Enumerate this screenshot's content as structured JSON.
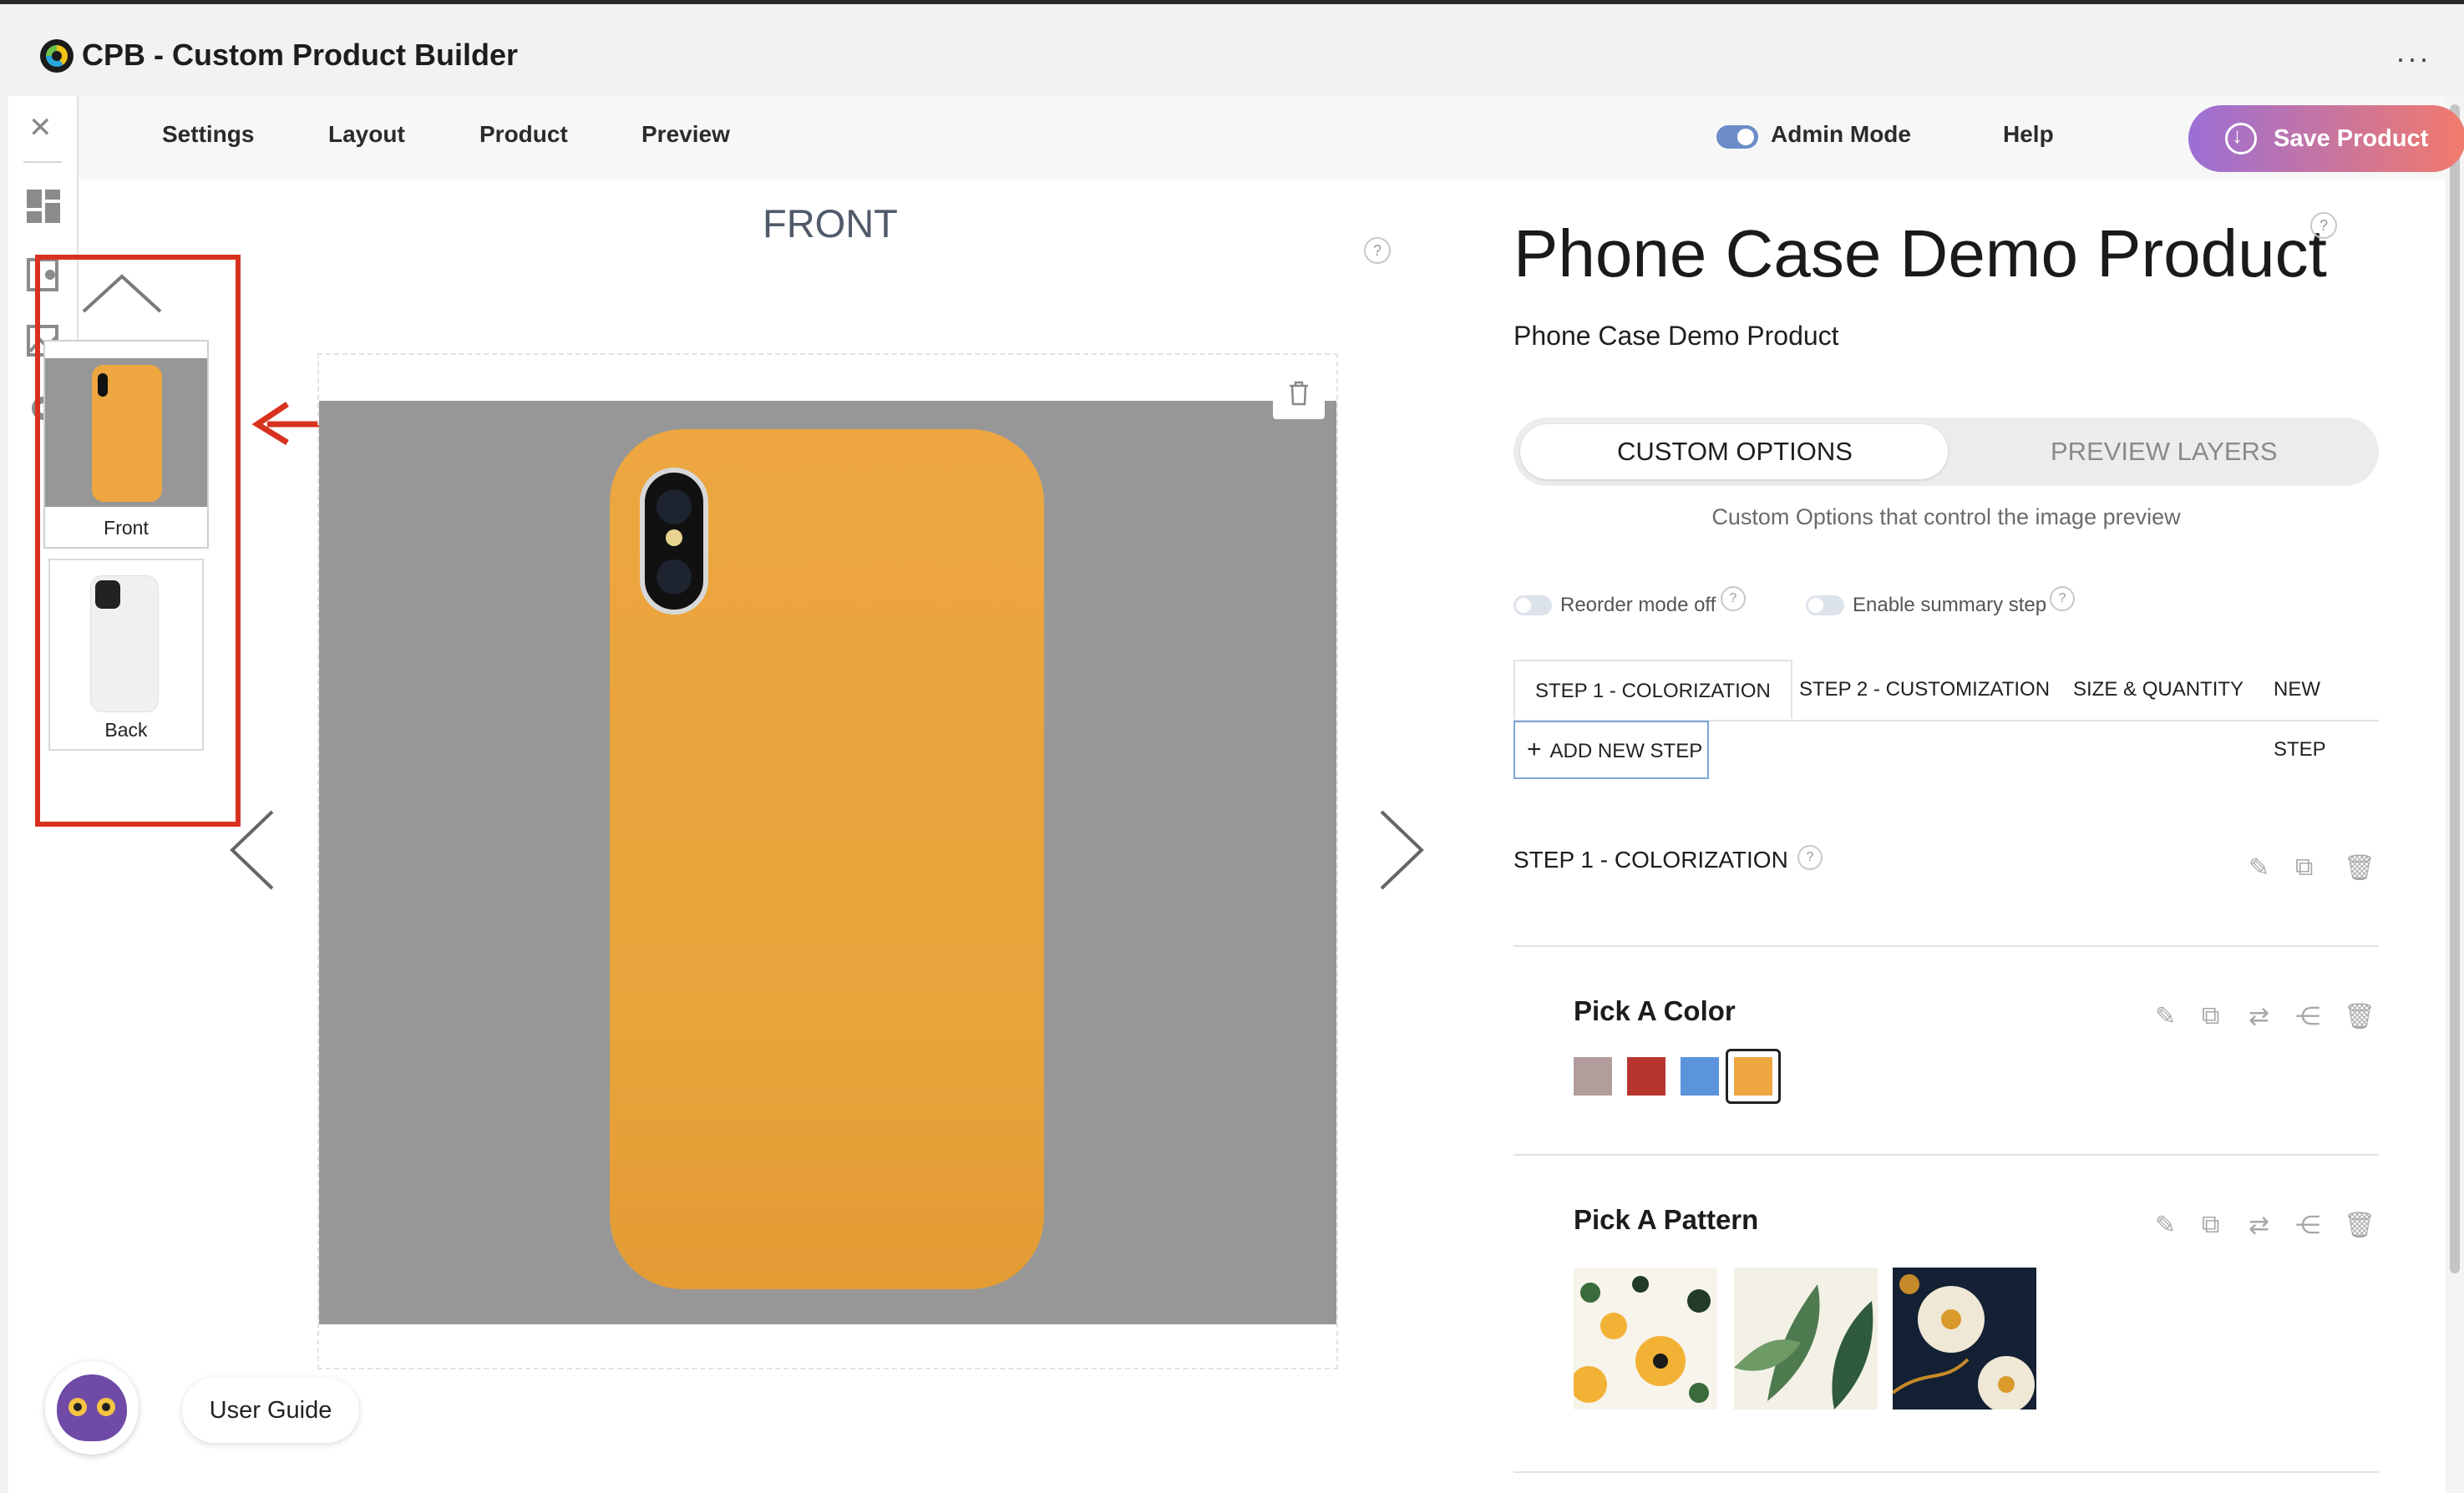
{
  "app": {
    "title": "CPB - Custom Product Builder",
    "more_icon": "more-horizontal-icon",
    "more_glyph": "···"
  },
  "nav": {
    "items": [
      "Settings",
      "Layout",
      "Product",
      "Preview"
    ],
    "admin_mode_label": "Admin Mode",
    "admin_mode_on": true,
    "help_label": "Help",
    "save_label": "Save Product"
  },
  "sidebar": {
    "close_glyph": "✕"
  },
  "views": {
    "items": [
      {
        "label": "Front",
        "selected": true
      },
      {
        "label": "Back",
        "selected": false
      }
    ]
  },
  "preview": {
    "view_title": "FRONT",
    "help_glyph": "?"
  },
  "product": {
    "title": "Phone Case Demo Product",
    "subtitle": "Phone Case Demo Product"
  },
  "panel": {
    "seg_options": "CUSTOM OPTIONS",
    "seg_layers": "PREVIEW LAYERS",
    "caption": "Custom Options that control the image preview",
    "reorder_label": "Reorder mode off",
    "summary_label": "Enable summary step",
    "tabs": [
      "STEP 1 - COLORIZATION",
      "STEP 2 - CUSTOMIZATION",
      "SIZE & QUANTITY",
      "NEW STEP"
    ],
    "add_step": "ADD NEW STEP",
    "add_step_glyph": "+",
    "step_title": "STEP 1 - COLORIZATION",
    "color_title": "Pick A Color",
    "colors": [
      "#b39c9c",
      "#b8352f",
      "#5b93dc",
      "#eda640"
    ],
    "selected_color": "#eda640",
    "pattern_title": "Pick A Pattern"
  },
  "user_guide": {
    "label": "User Guide"
  }
}
